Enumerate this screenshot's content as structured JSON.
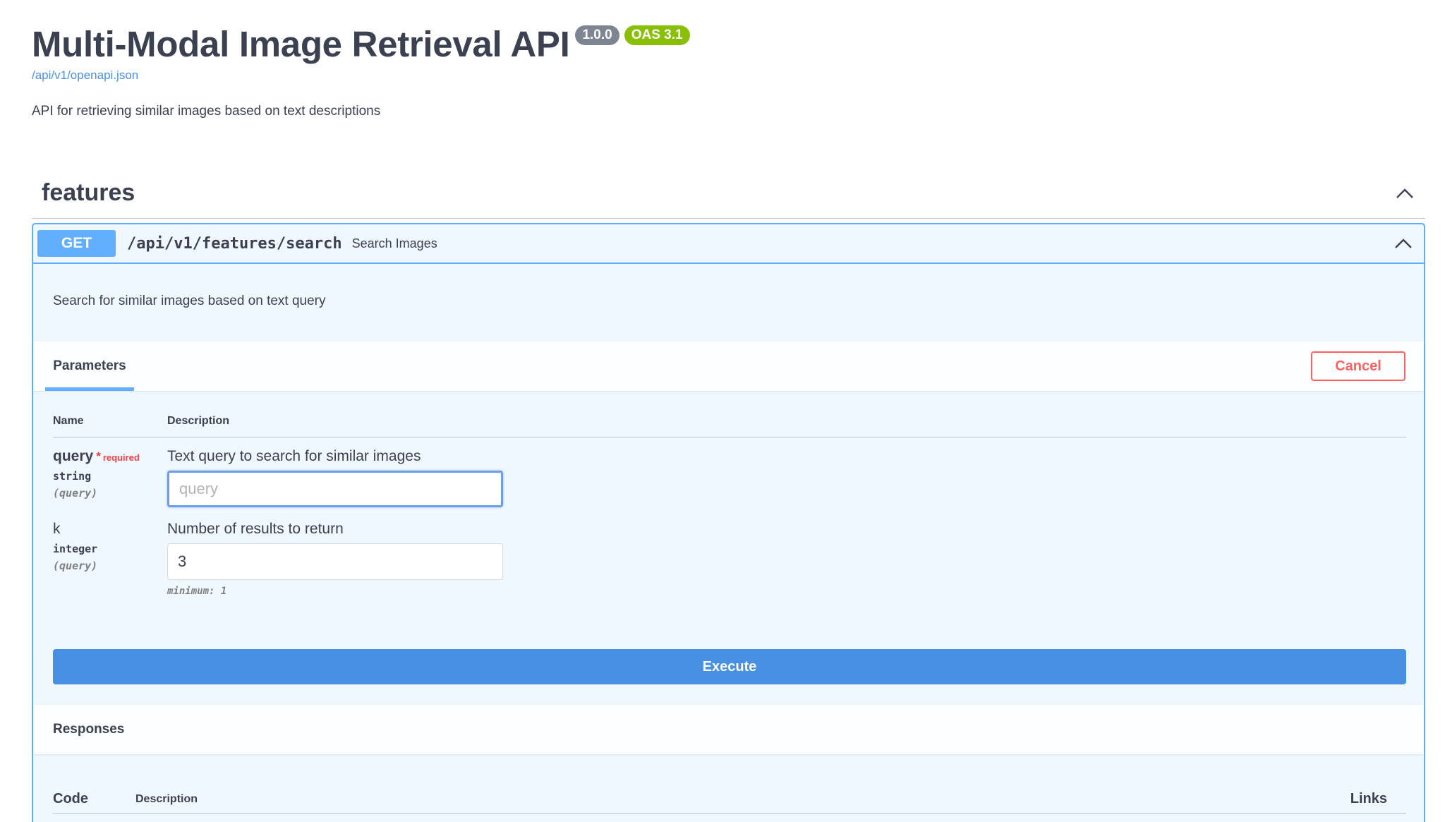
{
  "info": {
    "title": "Multi-Modal Image Retrieval API",
    "version": "1.0.0",
    "oas": "OAS 3.1",
    "spec_link": "/api/v1/openapi.json",
    "description": "API for retrieving similar images based on text descriptions"
  },
  "tag": {
    "name": "features",
    "chevron_icon": "chevron-up-icon"
  },
  "operation": {
    "method": "GET",
    "path": "/api/v1/features/search",
    "summary": "Search Images",
    "description": "Search for similar images based on text query",
    "chevron_icon": "chevron-up-icon"
  },
  "parameters": {
    "tab_label": "Parameters",
    "cancel_label": "Cancel",
    "col_name": "Name",
    "col_description": "Description",
    "items": [
      {
        "name": "query",
        "required_star": "*",
        "required_text": "required",
        "type": "string",
        "in": "(query)",
        "description": "Text query to search for similar images",
        "value": "",
        "placeholder": "query"
      },
      {
        "name": "k",
        "type": "integer",
        "in": "(query)",
        "description": "Number of results to return",
        "value": "3",
        "constraint": "minimum: 1"
      }
    ]
  },
  "execute_label": "Execute",
  "responses": {
    "title": "Responses",
    "col_code": "Code",
    "col_description": "Description",
    "col_links": "Links"
  },
  "colors": {
    "get_method": "#61affe",
    "execute": "#4990e2",
    "cancel": "#ff6060",
    "required": "#f93e3e",
    "version_badge": "#7d8492",
    "oas_badge": "#89bf04"
  }
}
